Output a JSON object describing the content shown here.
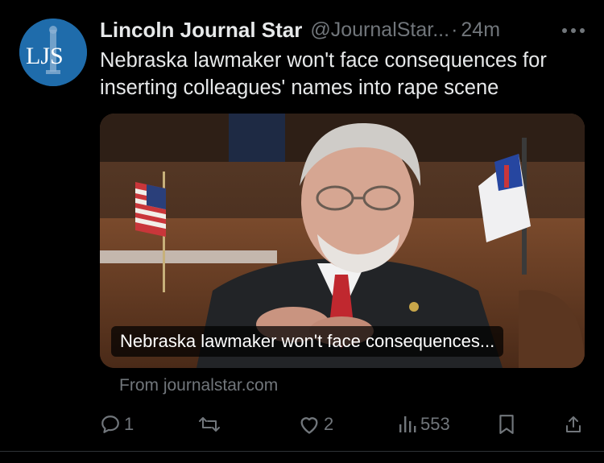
{
  "post": {
    "author_name": "Lincoln Journal Star",
    "handle": "@JournalStar...",
    "separator": "·",
    "time": "24m",
    "avatar_text": "LJS",
    "text": "Nebraska lawmaker won't face consequences for inserting colleagues' names into rape scene"
  },
  "card": {
    "caption": "Nebraska lawmaker won't face consequences...",
    "source": "From journalstar.com"
  },
  "actions": {
    "replies": "1",
    "reposts": "",
    "likes": "2",
    "views": "553"
  },
  "icons": {
    "more": "more-horizontal-icon",
    "reply": "reply-icon",
    "repost": "repost-icon",
    "like": "heart-icon",
    "views": "views-chart-icon",
    "bookmark": "bookmark-icon",
    "share": "share-icon"
  },
  "colors": {
    "background": "#000000",
    "text": "#e7e9ea",
    "muted": "#71767b",
    "avatar": "#1f6cab"
  }
}
